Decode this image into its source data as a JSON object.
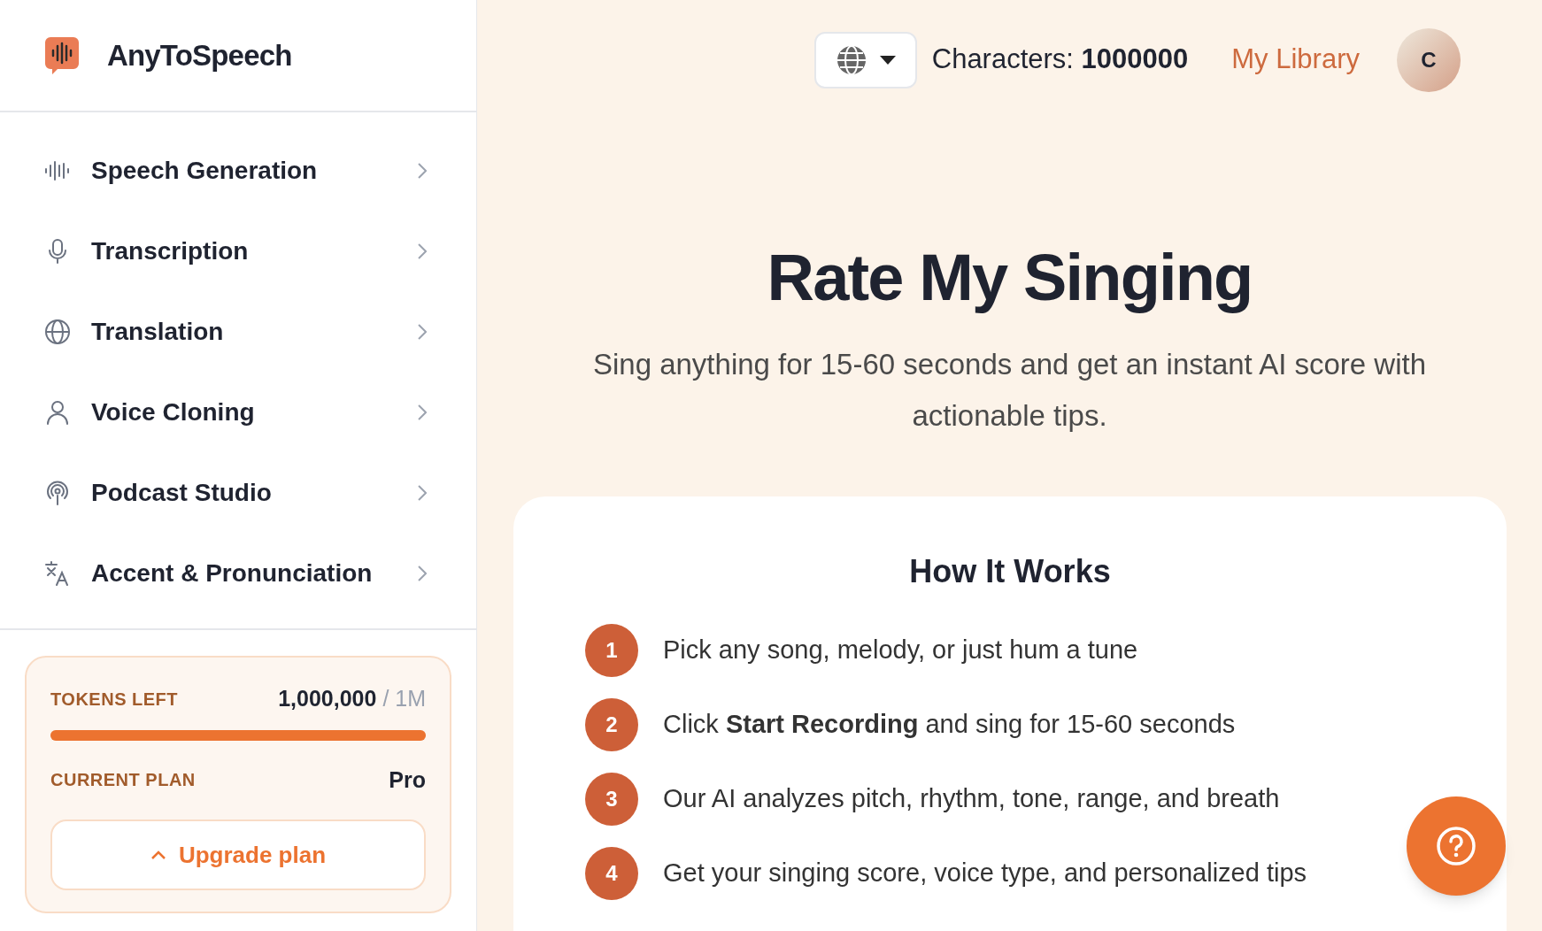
{
  "brand": "AnyToSpeech",
  "nav": [
    {
      "label": "Speech Generation",
      "kind": "wave"
    },
    {
      "label": "Transcription",
      "kind": "mic"
    },
    {
      "label": "Translation",
      "kind": "globe"
    },
    {
      "label": "Voice Cloning",
      "kind": "user"
    },
    {
      "label": "Podcast Studio",
      "kind": "podcast"
    },
    {
      "label": "Accent & Pronunciation",
      "kind": "language"
    }
  ],
  "usage": {
    "tokens_label": "TOKENS LEFT",
    "tokens_value": "1,000,000",
    "tokens_total": "/ 1M",
    "level": 1,
    "plan_label": "CURRENT PLAN",
    "plan_value": "Pro",
    "upgrade_button": "Upgrade plan"
  },
  "header": {
    "characters_label": "Characters:",
    "characters_value": "1000000",
    "library_link": "My Library",
    "avatar": "C"
  },
  "hero": {
    "title": "Rate My Singing",
    "subtitle": "Sing anything for 15-60 seconds and get an instant AI score with actionable tips."
  },
  "how_it_works": {
    "title": "How It Works",
    "steps": [
      {
        "number": "1",
        "text": "Pick any song, melody, or just hum a tune"
      },
      {
        "number": "2",
        "text": "Click **Start Recording** and sing for 15-60 seconds"
      },
      {
        "number": "3",
        "text": "Our AI analyzes pitch, rhythm, tone, range, and breath"
      },
      {
        "number": "4",
        "text": "Get your singing score, voice type, and personalized tips"
      }
    ]
  }
}
